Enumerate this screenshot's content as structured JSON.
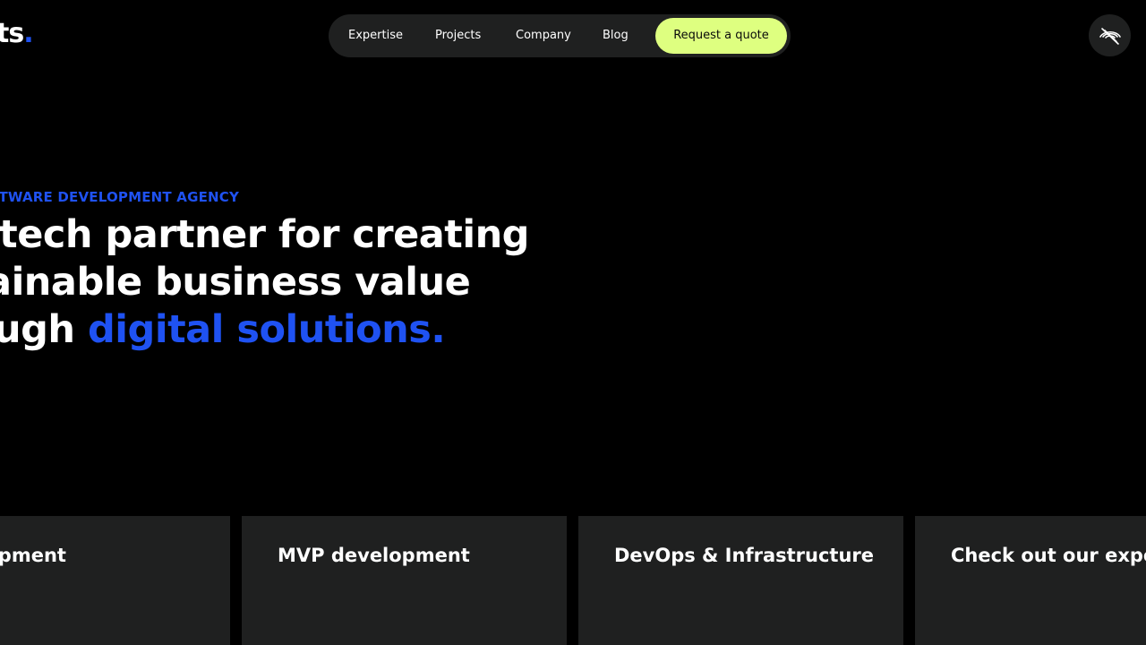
{
  "header": {
    "logo_text": "ts",
    "logo_dot": "."
  },
  "nav": {
    "items": [
      {
        "label": "Expertise"
      },
      {
        "label": "Projects"
      },
      {
        "label": "Company"
      },
      {
        "label": "Blog"
      }
    ],
    "cta_label": "Request a quote"
  },
  "accessibility": {
    "icon": "eye-slash-icon"
  },
  "hero": {
    "eyebrow": "FTWARE DEVELOPMENT AGENCY",
    "line1": "r tech partner for creating",
    "line2": "tainable business value",
    "line3_prefix": "ough ",
    "line3_accent": "digital solutions."
  },
  "cards": [
    {
      "title": "evelopment"
    },
    {
      "title": "MVP development"
    },
    {
      "title": "DevOps & Infrastructure"
    },
    {
      "title": "Check out our expertise"
    }
  ],
  "colors": {
    "background": "#000000",
    "accent_blue": "#1f52f2",
    "cta_lime": "#deff80",
    "surface": "#1f2020"
  }
}
